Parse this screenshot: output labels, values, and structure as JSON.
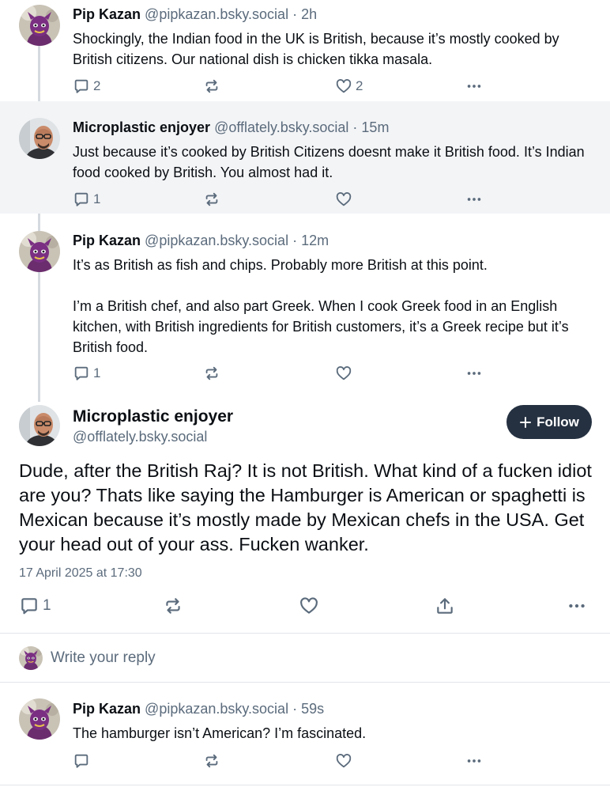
{
  "posts": [
    {
      "author": "Pip Kazan",
      "handle": "@pipkazan.bsky.social",
      "sep": " · ",
      "time": "2h",
      "paragraphs": [
        "Shockingly, the Indian food in the UK is British, because it’s mostly cooked by British citizens. Our national dish is chicken tikka masala."
      ],
      "reply_count": "2",
      "repost_count": "",
      "like_count": "2"
    },
    {
      "author": "Microplastic enjoyer",
      "handle": "@offlately.bsky.social",
      "sep": " · ",
      "time": "15m",
      "paragraphs": [
        "Just because it’s cooked by British Citizens doesnt make it British food. It’s Indian food cooked  by British. You almost had it."
      ],
      "reply_count": "1",
      "repost_count": "",
      "like_count": ""
    },
    {
      "author": "Pip Kazan",
      "handle": "@pipkazan.bsky.social",
      "sep": " · ",
      "time": "12m",
      "paragraphs": [
        "It’s as British as fish and chips. Probably more British at this point.",
        "I’m a British chef, and also part Greek. When I cook Greek food in an English kitchen, with British ingredients for British customers, it’s a Greek recipe but it’s British food."
      ],
      "reply_count": "1",
      "repost_count": "",
      "like_count": ""
    }
  ],
  "main_post": {
    "author": "Microplastic enjoyer",
    "handle": "@offlately.bsky.social",
    "follow_label": "Follow",
    "text": "Dude, after the British Raj? It is not British. What kind of a fucken idiot are you? Thats like saying the Hamburger is American or spaghetti is Mexican because it’s mostly made by Mexican chefs in the USA. Get your head out of your ass. Fucken wanker.",
    "date": "17 April 2025 at 17:30",
    "reply_count": "1"
  },
  "composer": {
    "placeholder": "Write your reply"
  },
  "replies": [
    {
      "author": "Pip Kazan",
      "handle": "@pipkazan.bsky.social",
      "sep": " · ",
      "time": "59s",
      "text": "The hamburger isn’t American? I’m fascinated."
    }
  ],
  "colors": {
    "accent_button": "#253141",
    "muted_text": "#5b6b7c",
    "highlight_bg": "#f3f4f6",
    "thread_line": "#d5dae0"
  },
  "icons": [
    "reply-icon",
    "repost-icon",
    "like-icon",
    "share-icon",
    "more-icon",
    "plus-icon"
  ]
}
